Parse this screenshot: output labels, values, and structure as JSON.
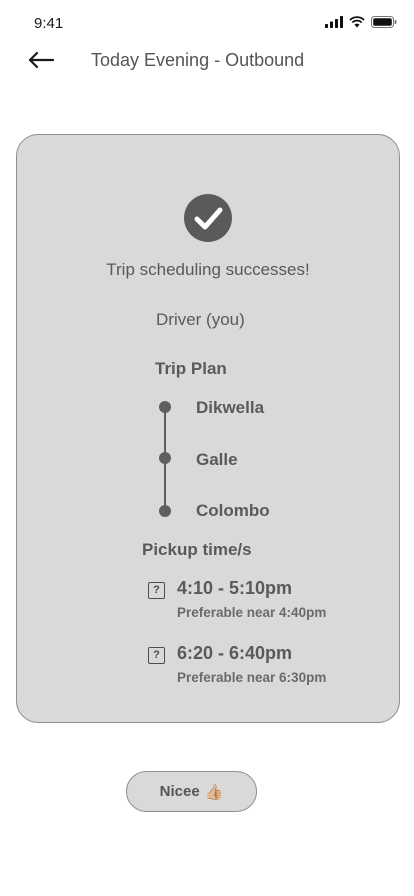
{
  "status_bar": {
    "time": "9:41"
  },
  "nav": {
    "title": "Today Evening - Outbound"
  },
  "card": {
    "success_message": "Trip scheduling successes!",
    "role": "Driver (you)",
    "trip_plan_label": "Trip Plan",
    "stops": [
      "Dikwella",
      "Galle",
      "Colombo"
    ],
    "pickup_label": "Pickup time/s",
    "pickups": [
      {
        "range": "4:10 - 5:10pm",
        "note": "Preferable near 4:40pm"
      },
      {
        "range": "6:20 - 6:40pm",
        "note": "Preferable near 6:30pm"
      }
    ]
  },
  "action": {
    "label": "Nicee",
    "emoji": "👍🏼"
  },
  "icons": {
    "status": [
      "signal-icon",
      "wifi-icon",
      "battery-icon"
    ],
    "back": "back-arrow-icon",
    "success": "checkmark-icon",
    "pickup": "question-icon"
  }
}
